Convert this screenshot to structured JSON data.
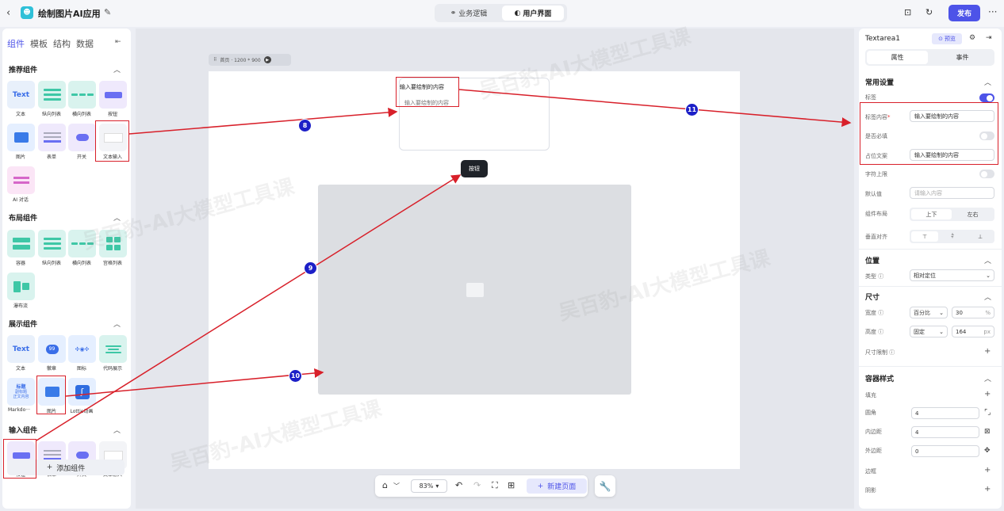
{
  "topbar": {
    "app_title": "绘制图片AI应用",
    "mode_tabs": [
      {
        "label": "业务逻辑",
        "active": false
      },
      {
        "label": "用户界面",
        "active": true
      }
    ],
    "publish_label": "发布"
  },
  "left_panel": {
    "tabs": [
      "组件",
      "模板",
      "结构",
      "数据"
    ],
    "sections": {
      "recommended": {
        "title": "推荐组件",
        "items": [
          "文本",
          "纵向列表",
          "横向列表",
          "按钮",
          "图片",
          "表单",
          "开关",
          "文本输入",
          "AI 对话"
        ]
      },
      "layout": {
        "title": "布局组件",
        "items": [
          "容器",
          "纵向列表",
          "横向列表",
          "宫格列表",
          "瀑布流"
        ]
      },
      "display": {
        "title": "展示组件",
        "items": [
          "文本",
          "徽章",
          "图标",
          "代码展示",
          "Markdo···",
          "图片",
          "Lottie动画"
        ]
      },
      "input": {
        "title": "输入组件",
        "items": [
          "按钮",
          "表单",
          "开关",
          "文本输入"
        ]
      }
    },
    "icon_texts": {
      "text": "Text",
      "badge": "99",
      "markdown_title": "标题",
      "markdown_line2": "副标题",
      "markdown_line3": "正文内容"
    },
    "add_button": "添加组件"
  },
  "canvas": {
    "page_label": "首页 · 1200 * 900",
    "textarea_label": "输入要绘制的内容",
    "textarea_placeholder": "输入要绘制的内容",
    "button_label": "按钮"
  },
  "bottom_toolbar": {
    "zoom": "83%",
    "new_page": "新建页面"
  },
  "right_panel": {
    "component_name": "Textarea1",
    "preview_label": "预览",
    "tabs": [
      {
        "label": "属性",
        "active": true
      },
      {
        "label": "事件",
        "active": false
      }
    ],
    "common": {
      "title": "常用设置",
      "label_toggle": "标签",
      "label_content": "标签内容",
      "required_mark": "*",
      "label_content_value": "输入要绘制的内容",
      "required": "是否必填",
      "placeholder": "占位文案",
      "placeholder_value": "输入要绘制的内容",
      "char_limit": "字符上限",
      "default_value": "默认值",
      "default_value_placeholder": "请输入内容",
      "layout": "组件布局",
      "layout_options": [
        "上下",
        "左右"
      ],
      "vertical_align": "垂直对齐"
    },
    "position": {
      "title": "位置",
      "type_label": "类型",
      "type_value": "相对定位"
    },
    "size": {
      "title": "尺寸",
      "width_label": "宽度",
      "width_mode": "百分比",
      "width_value": "30",
      "width_unit": "%",
      "height_label": "高度",
      "height_mode": "固定",
      "height_value": "164",
      "height_unit": "px",
      "limit_label": "尺寸限制"
    },
    "container_style": {
      "title": "容器样式",
      "fill": "填充",
      "radius": "圆角",
      "radius_value": "4",
      "padding": "内边距",
      "padding_value": "4",
      "margin": "外边距",
      "margin_value": "0",
      "border": "边框",
      "shadow": "阴影"
    }
  },
  "annotations": [
    "8",
    "9",
    "10",
    "11"
  ],
  "watermark": "吴百豹-AI大模型工具课"
}
